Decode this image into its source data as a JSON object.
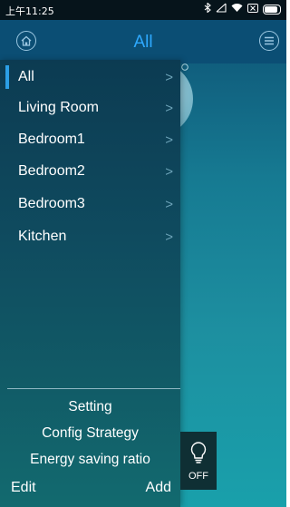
{
  "status_bar": {
    "time": "上午11:25",
    "icons": [
      "bluetooth-icon",
      "no-signal-icon",
      "wifi-icon",
      "sim-icon",
      "battery-icon"
    ],
    "battery_level": 0.9
  },
  "header": {
    "title": "All",
    "home_icon": "home-icon",
    "menu_icon": "menu-icon"
  },
  "drawer": {
    "items": [
      {
        "label": "All",
        "active": true
      },
      {
        "label": "Living Room"
      },
      {
        "label": "Bedroom1"
      },
      {
        "label": "Bedroom2"
      },
      {
        "label": "Bedroom3"
      },
      {
        "label": "Kitchen"
      }
    ],
    "chevron": ">",
    "footer": {
      "setting": "Setting",
      "config_strategy": "Config Strategy",
      "energy_saving_ratio": "Energy saving ratio",
      "edit": "Edit",
      "add": "Add"
    }
  },
  "off_button": {
    "label": "OFF",
    "icon": "bulb-icon"
  },
  "colors": {
    "header_bg": "#0b4e74",
    "title_accent": "#2ea9ff",
    "active_indicator": "#2c9fe6"
  }
}
